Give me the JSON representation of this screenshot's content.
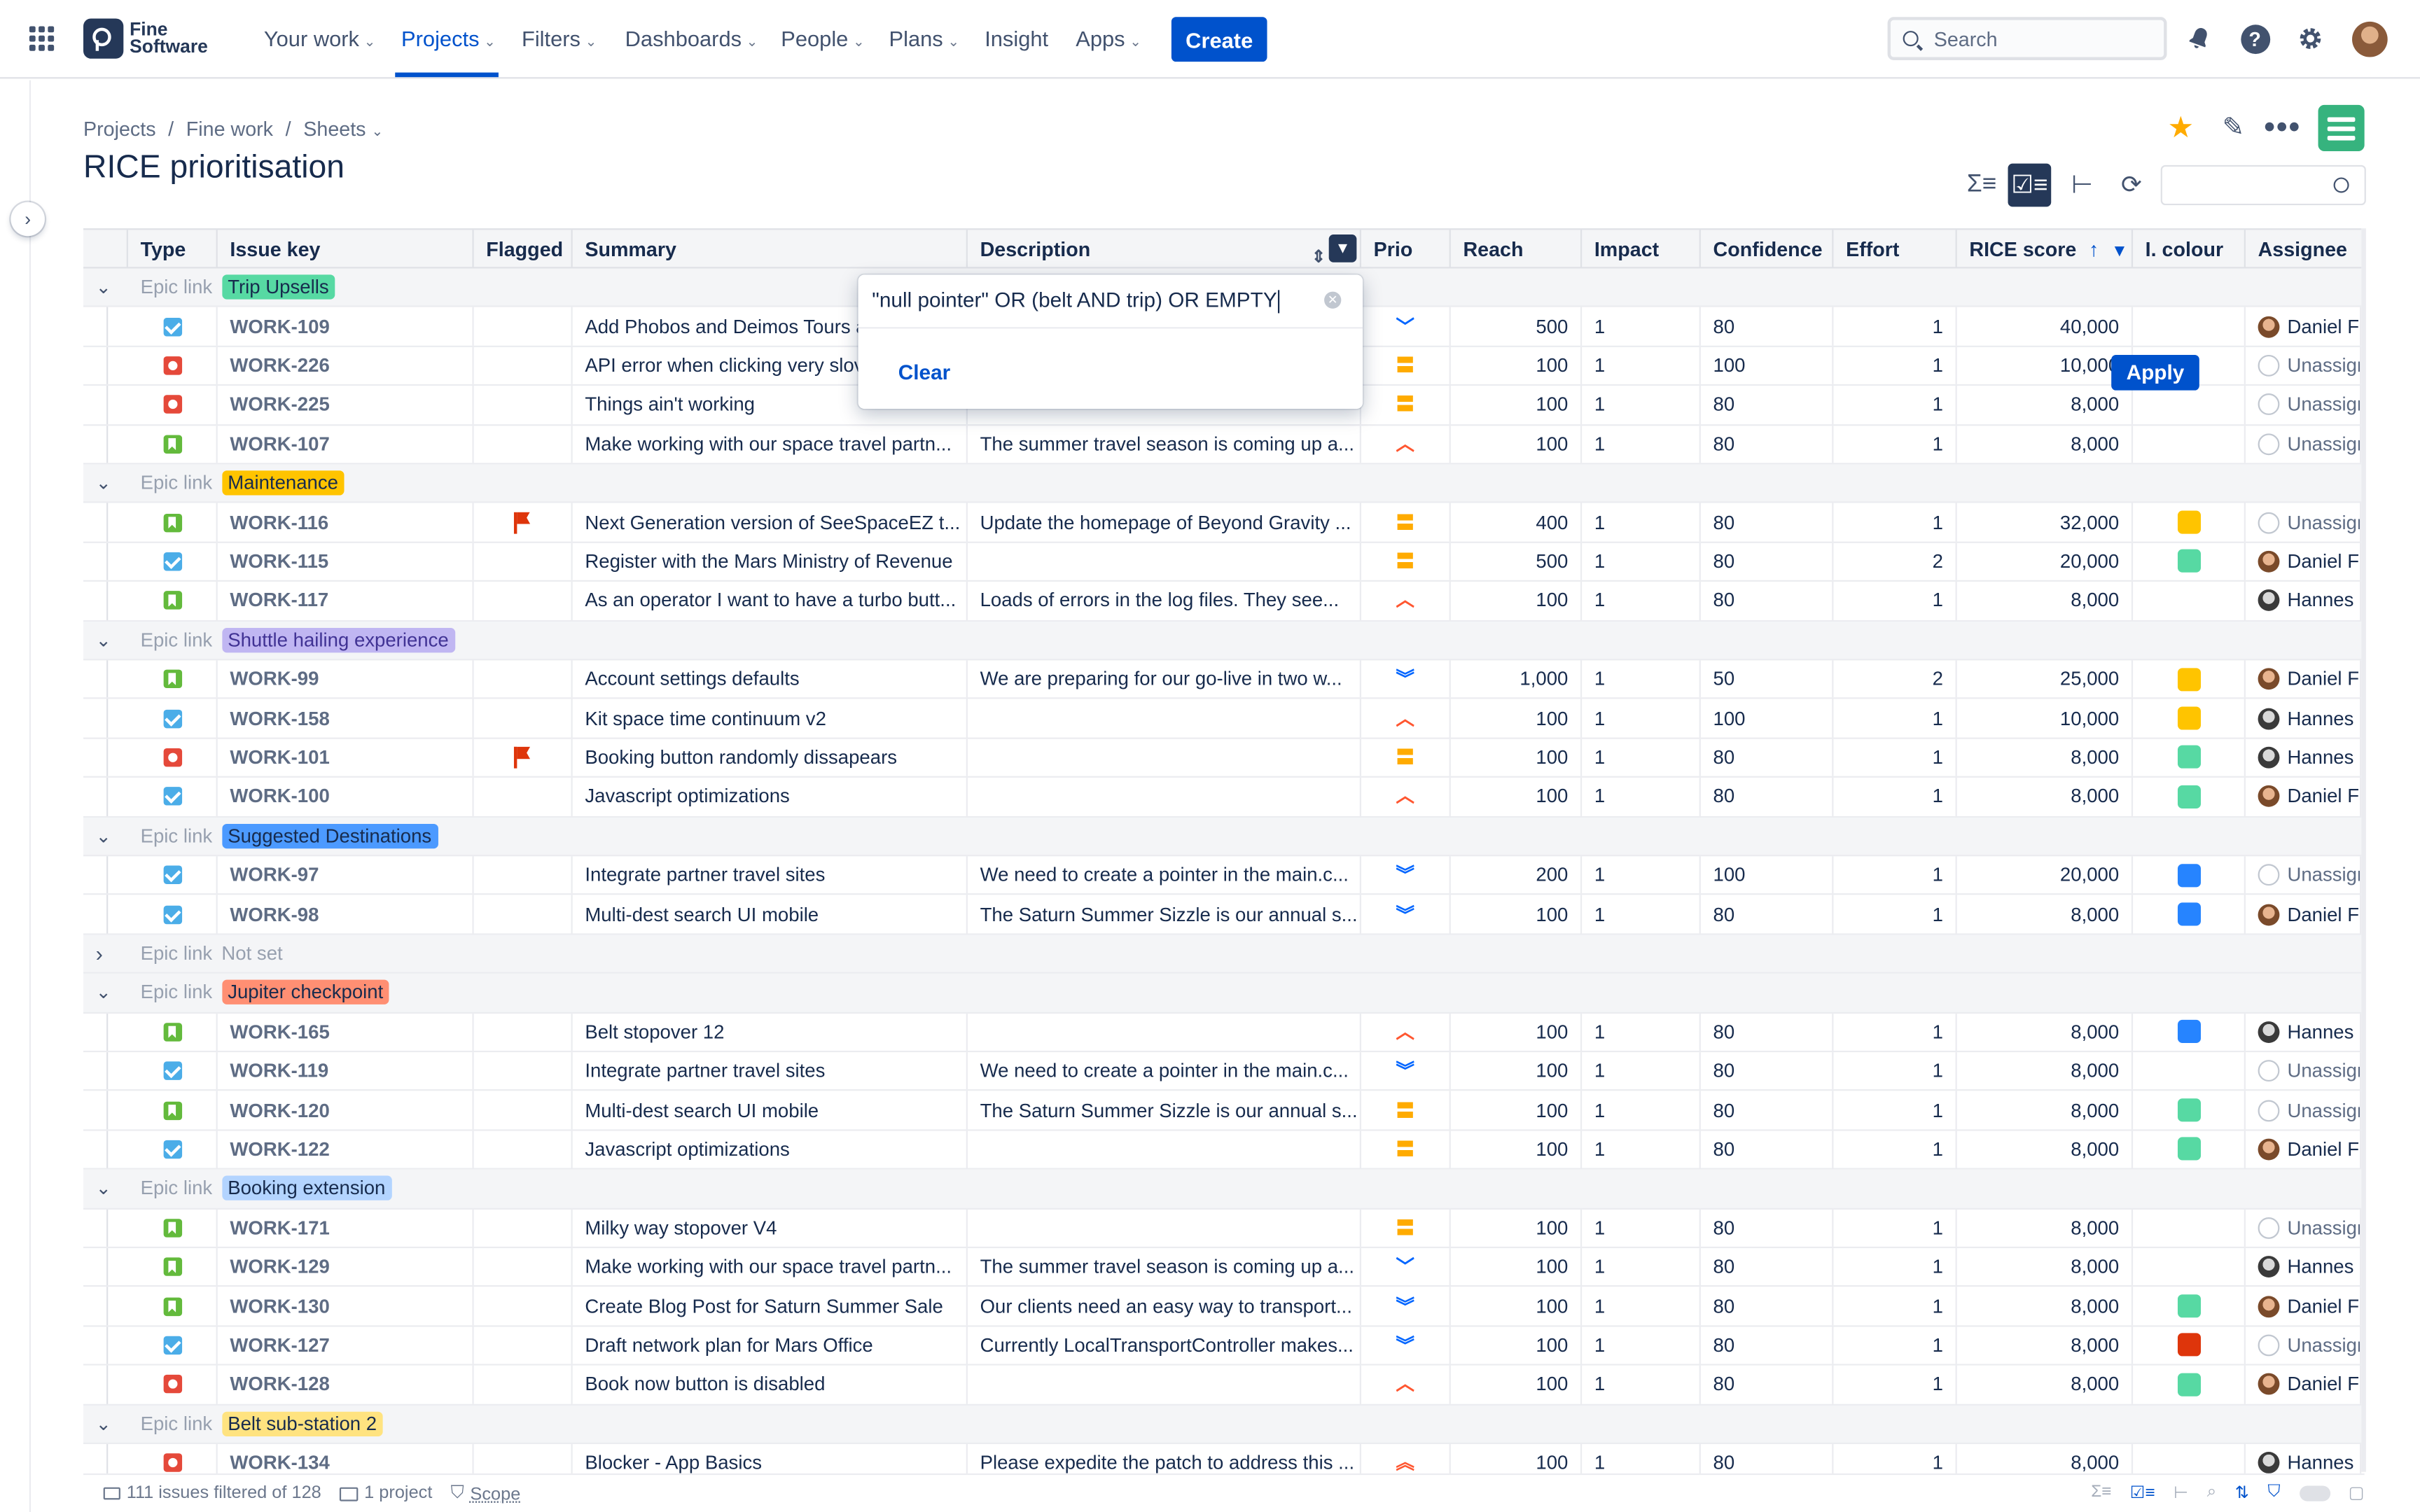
{
  "app": {
    "logo_text": "Fine Software",
    "nav": [
      {
        "label": "Your work",
        "has_menu": true,
        "active": false
      },
      {
        "label": "Projects",
        "has_menu": true,
        "active": true
      },
      {
        "label": "Filters",
        "has_menu": true,
        "active": false
      },
      {
        "label": "Dashboards",
        "has_menu": true,
        "active": false
      },
      {
        "label": "People",
        "has_menu": true,
        "active": false
      },
      {
        "label": "Plans",
        "has_menu": true,
        "active": false
      },
      {
        "label": "Insight",
        "has_menu": false,
        "active": false
      },
      {
        "label": "Apps",
        "has_menu": true,
        "active": false
      }
    ],
    "create_label": "Create",
    "search_placeholder": "Search",
    "accent": "#0052cc"
  },
  "breadcrumb": [
    "Projects",
    "Fine work",
    "Sheets"
  ],
  "page_title": "RICE prioritisation",
  "columns": [
    "Type",
    "Issue key",
    "Flagged",
    "Summary",
    "Description",
    "Prio",
    "Reach",
    "Impact",
    "Confidence",
    "Effort",
    "RICE score",
    "I. colour",
    "Assignee"
  ],
  "filter_popup": {
    "query": "\"null pointer\" OR (belt AND trip) OR EMPTY",
    "clear_label": "Clear",
    "apply_label": "Apply"
  },
  "groups": [
    {
      "label": "Epic link",
      "name": "Trip Upsells",
      "color": "#57d9a3",
      "text": "#172b4d",
      "collapsed": false,
      "rows": [
        {
          "type": "task",
          "key": "WORK-109",
          "flagged": false,
          "summary": "Add Phobos and Deimos Tours a",
          "description": "",
          "prio": "low",
          "reach": "500",
          "impact": "1",
          "confidence": "80",
          "effort": "1",
          "rice": "40,000",
          "colour": "",
          "assignee": "Daniel Fr"
        },
        {
          "type": "bug",
          "key": "WORK-226",
          "flagged": false,
          "summary": "API error when clicking very slov",
          "description": "",
          "prio": "medium",
          "reach": "100",
          "impact": "1",
          "confidence": "100",
          "effort": "1",
          "rice": "10,000",
          "colour": "",
          "assignee": "Unassign"
        },
        {
          "type": "bug",
          "key": "WORK-225",
          "flagged": false,
          "summary": "Things ain't working",
          "description": "",
          "prio": "medium",
          "reach": "100",
          "impact": "1",
          "confidence": "80",
          "effort": "1",
          "rice": "8,000",
          "colour": "",
          "assignee": "Unassign"
        },
        {
          "type": "story",
          "key": "WORK-107",
          "flagged": false,
          "summary": "Make working with our space travel partn...",
          "description": "The summer travel season is coming up a...",
          "prio": "high",
          "reach": "100",
          "impact": "1",
          "confidence": "80",
          "effort": "1",
          "rice": "8,000",
          "colour": "",
          "assignee": "Unassign"
        }
      ]
    },
    {
      "label": "Epic link",
      "name": "Maintenance",
      "color": "#ffc400",
      "text": "#172b4d",
      "collapsed": false,
      "rows": [
        {
          "type": "story",
          "key": "WORK-116",
          "flagged": true,
          "summary": "Next Generation version of SeeSpaceEZ t...",
          "description": "Update the homepage of Beyond Gravity ...",
          "prio": "medium",
          "reach": "400",
          "impact": "1",
          "confidence": "80",
          "effort": "1",
          "rice": "32,000",
          "colour": "#ffc400",
          "assignee": "Unassign"
        },
        {
          "type": "task",
          "key": "WORK-115",
          "flagged": false,
          "summary": "Register with the Mars Ministry of Revenue",
          "description": "",
          "prio": "medium",
          "reach": "500",
          "impact": "1",
          "confidence": "80",
          "effort": "2",
          "rice": "20,000",
          "colour": "#57d9a3",
          "assignee": "Daniel Fr"
        },
        {
          "type": "story",
          "key": "WORK-117",
          "flagged": false,
          "summary": "As an operator I want to have a turbo butt...",
          "description": "Loads of errors in the log files. They see...",
          "prio": "high",
          "reach": "100",
          "impact": "1",
          "confidence": "80",
          "effort": "1",
          "rice": "8,000",
          "colour": "",
          "assignee": "Hannes G"
        }
      ]
    },
    {
      "label": "Epic link",
      "name": "Shuttle hailing experience",
      "color": "#c0b6f2",
      "text": "#403294",
      "collapsed": false,
      "rows": [
        {
          "type": "story",
          "key": "WORK-99",
          "flagged": false,
          "summary": "Account settings defaults",
          "description": "We are preparing for our go-live in two w...",
          "prio": "lowest",
          "reach": "1,000",
          "impact": "1",
          "confidence": "50",
          "effort": "2",
          "rice": "25,000",
          "colour": "#ffc400",
          "assignee": "Daniel Fr"
        },
        {
          "type": "task",
          "key": "WORK-158",
          "flagged": false,
          "summary": "Kit space time continuum v2",
          "description": "",
          "prio": "high",
          "reach": "100",
          "impact": "1",
          "confidence": "100",
          "effort": "1",
          "rice": "10,000",
          "colour": "#ffc400",
          "assignee": "Hannes G"
        },
        {
          "type": "bug",
          "key": "WORK-101",
          "flagged": true,
          "summary": "Booking button randomly dissapears",
          "description": "",
          "prio": "medium",
          "reach": "100",
          "impact": "1",
          "confidence": "80",
          "effort": "1",
          "rice": "8,000",
          "colour": "#57d9a3",
          "assignee": "Hannes G"
        },
        {
          "type": "task",
          "key": "WORK-100",
          "flagged": false,
          "summary": "Javascript optimizations",
          "description": "",
          "prio": "high",
          "reach": "100",
          "impact": "1",
          "confidence": "80",
          "effort": "1",
          "rice": "8,000",
          "colour": "#57d9a3",
          "assignee": "Daniel Fr"
        }
      ]
    },
    {
      "label": "Epic link",
      "name": "Suggested Destinations",
      "color": "#4c9aff",
      "text": "#172b4d",
      "collapsed": false,
      "rows": [
        {
          "type": "task",
          "key": "WORK-97",
          "flagged": false,
          "summary": "Integrate partner travel sites",
          "description": "We need to create a pointer in the main.c...",
          "prio": "lowest",
          "reach": "200",
          "impact": "1",
          "confidence": "100",
          "effort": "1",
          "rice": "20,000",
          "colour": "#2684ff",
          "assignee": "Unassign"
        },
        {
          "type": "task",
          "key": "WORK-98",
          "flagged": false,
          "summary": "Multi-dest search UI mobile",
          "description": "The Saturn Summer Sizzle is our annual s...",
          "prio": "lowest",
          "reach": "100",
          "impact": "1",
          "confidence": "80",
          "effort": "1",
          "rice": "8,000",
          "colour": "#2684ff",
          "assignee": "Daniel Fr"
        }
      ]
    },
    {
      "label": "Epic link",
      "name": "Not set",
      "color": "",
      "text": "#97a0af",
      "collapsed": true,
      "rows": []
    },
    {
      "label": "Epic link",
      "name": "Jupiter checkpoint",
      "color": "#ff8f73",
      "text": "#172b4d",
      "collapsed": false,
      "rows": [
        {
          "type": "story",
          "key": "WORK-165",
          "flagged": false,
          "summary": "Belt stopover 12",
          "description": "",
          "prio": "high",
          "reach": "100",
          "impact": "1",
          "confidence": "80",
          "effort": "1",
          "rice": "8,000",
          "colour": "#2684ff",
          "assignee": "Hannes G"
        },
        {
          "type": "task",
          "key": "WORK-119",
          "flagged": false,
          "summary": "Integrate partner travel sites",
          "description": "We need to create a pointer in the main.c...",
          "prio": "lowest",
          "reach": "100",
          "impact": "1",
          "confidence": "80",
          "effort": "1",
          "rice": "8,000",
          "colour": "",
          "assignee": "Unassign"
        },
        {
          "type": "story",
          "key": "WORK-120",
          "flagged": false,
          "summary": "Multi-dest search UI mobile",
          "description": "The Saturn Summer Sizzle is our annual s...",
          "prio": "medium",
          "reach": "100",
          "impact": "1",
          "confidence": "80",
          "effort": "1",
          "rice": "8,000",
          "colour": "#57d9a3",
          "assignee": "Unassign"
        },
        {
          "type": "task",
          "key": "WORK-122",
          "flagged": false,
          "summary": "Javascript optimizations",
          "description": "",
          "prio": "medium",
          "reach": "100",
          "impact": "1",
          "confidence": "80",
          "effort": "1",
          "rice": "8,000",
          "colour": "#57d9a3",
          "assignee": "Daniel Fr"
        }
      ]
    },
    {
      "label": "Epic link",
      "name": "Booking extension",
      "color": "#b3d4ff",
      "text": "#172b4d",
      "collapsed": false,
      "rows": [
        {
          "type": "story",
          "key": "WORK-171",
          "flagged": false,
          "summary": "Milky way stopover V4",
          "description": "",
          "prio": "medium",
          "reach": "100",
          "impact": "1",
          "confidence": "80",
          "effort": "1",
          "rice": "8,000",
          "colour": "",
          "assignee": "Unassign"
        },
        {
          "type": "story",
          "key": "WORK-129",
          "flagged": false,
          "summary": "Make working with our space travel partn...",
          "description": "The summer travel season is coming up a...",
          "prio": "low",
          "reach": "100",
          "impact": "1",
          "confidence": "80",
          "effort": "1",
          "rice": "8,000",
          "colour": "",
          "assignee": "Hannes G"
        },
        {
          "type": "story",
          "key": "WORK-130",
          "flagged": false,
          "summary": "Create Blog Post for Saturn Summer Sale",
          "description": "Our clients need an easy way to transport...",
          "prio": "lowest",
          "reach": "100",
          "impact": "1",
          "confidence": "80",
          "effort": "1",
          "rice": "8,000",
          "colour": "#57d9a3",
          "assignee": "Daniel Fr"
        },
        {
          "type": "task",
          "key": "WORK-127",
          "flagged": false,
          "summary": "Draft network plan for Mars Office",
          "description": "Currently LocalTransportController makes...",
          "prio": "lowest",
          "reach": "100",
          "impact": "1",
          "confidence": "80",
          "effort": "1",
          "rice": "8,000",
          "colour": "#de350b",
          "assignee": "Unassign"
        },
        {
          "type": "bug",
          "key": "WORK-128",
          "flagged": false,
          "summary": "Book now button is disabled",
          "description": "",
          "prio": "high",
          "reach": "100",
          "impact": "1",
          "confidence": "80",
          "effort": "1",
          "rice": "8,000",
          "colour": "#57d9a3",
          "assignee": "Daniel Fr"
        }
      ]
    },
    {
      "label": "Epic link",
      "name": "Belt sub-station 2",
      "color": "#ffe380",
      "text": "#172b4d",
      "collapsed": false,
      "rows": [
        {
          "type": "bug",
          "key": "WORK-134",
          "flagged": false,
          "summary": "Blocker - App Basics",
          "description": "Please expedite the patch to address this ...",
          "prio": "highest",
          "reach": "100",
          "impact": "1",
          "confidence": "80",
          "effort": "1",
          "rice": "8,000",
          "colour": "",
          "assignee": "Hannes G"
        }
      ]
    }
  ],
  "footer": {
    "count": "111 issues filtered of 128",
    "projects": "1 project",
    "scope": "Scope"
  }
}
